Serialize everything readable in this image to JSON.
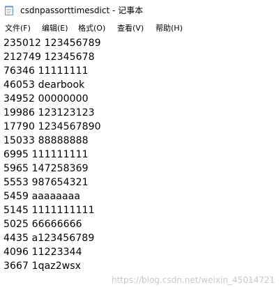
{
  "window": {
    "title": "csdnpassorttimesdict - 记事本",
    "icon": "notepad-icon"
  },
  "menu": {
    "items": [
      {
        "label": "文件(F)"
      },
      {
        "label": "编辑(E)"
      },
      {
        "label": "格式(O)"
      },
      {
        "label": "查看(V)"
      },
      {
        "label": "帮助(H)"
      }
    ]
  },
  "editor": {
    "lines": [
      "235012 123456789",
      "212749 12345678",
      "76346 11111111",
      "46053 dearbook",
      "34952 00000000",
      "19986 123123123",
      "17790 1234567890",
      "15033 88888888",
      "6995 111111111",
      "5965 147258369",
      "5553 987654321",
      "5459 aaaaaaaa",
      "5145 1111111111",
      "5025 66666666",
      "4435 a123456789",
      "4096 11223344",
      "3667 1qaz2wsx"
    ]
  },
  "watermark": "https://blog.csdn.net/weixin_45014721"
}
